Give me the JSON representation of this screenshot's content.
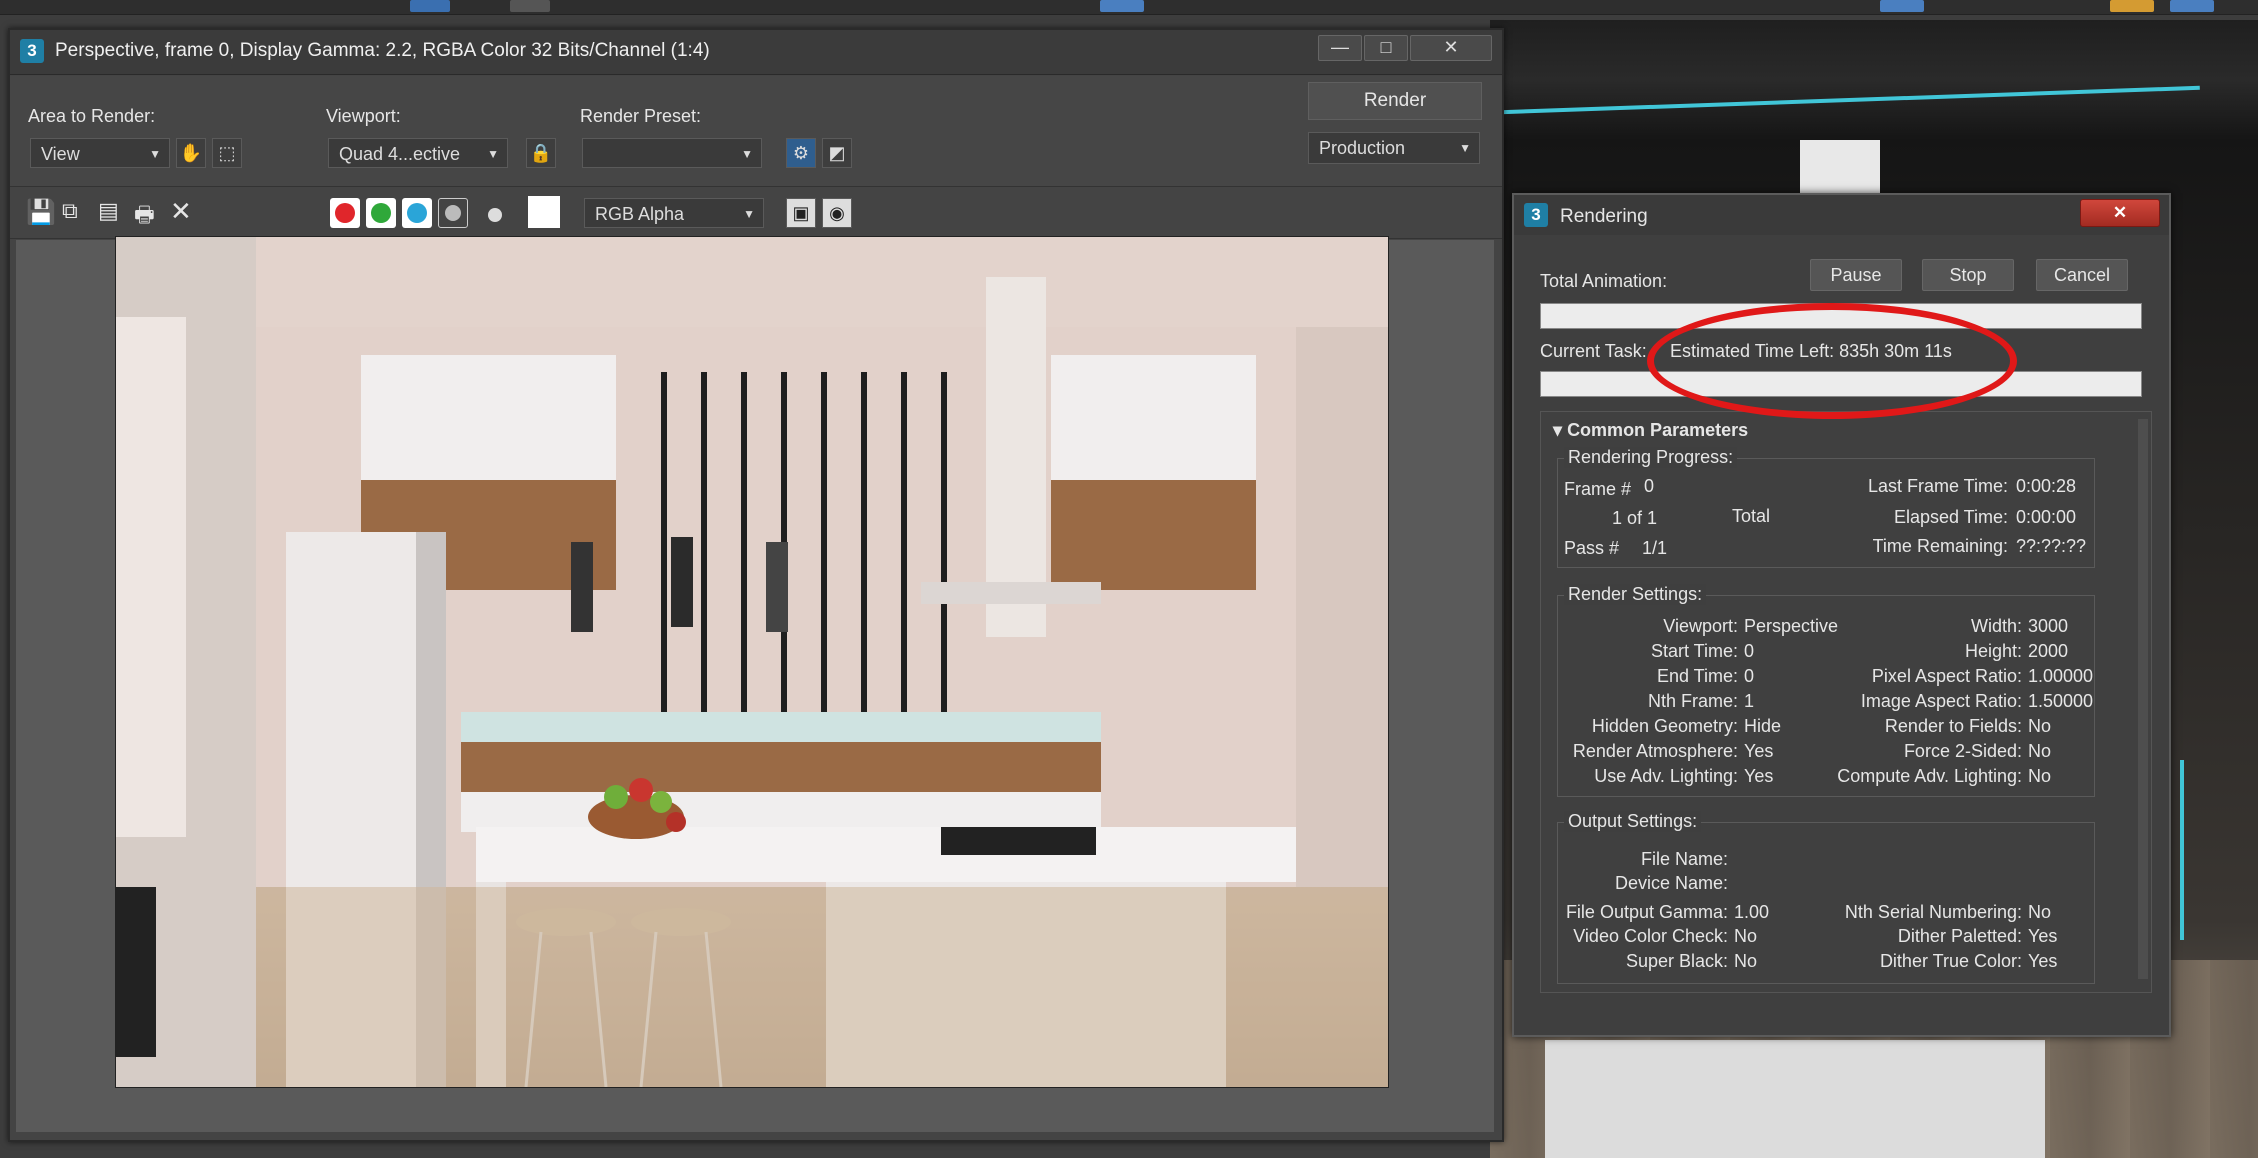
{
  "frame_window": {
    "title": "Perspective, frame 0, Display Gamma: 2.2, RGBA Color 32 Bits/Channel (1:4)",
    "app_icon": "3",
    "minimize": "—",
    "restore": "□",
    "close": "✕",
    "area_to_render_label": "Area to Render:",
    "area_to_render_value": "View",
    "viewport_label": "Viewport:",
    "viewport_value": "Quad 4...ective",
    "render_preset_label": "Render Preset:",
    "render_preset_value": "",
    "render_button": "Render",
    "production_value": "Production",
    "channel_value": "RGB Alpha",
    "channel_colors": {
      "red": "#e0262b",
      "green": "#2fa83a",
      "blue": "#2aa5d8"
    }
  },
  "rendering_dialog": {
    "icon": "3",
    "title": "Rendering",
    "close": "✕",
    "total_animation_label": "Total Animation:",
    "pause": "Pause",
    "stop": "Stop",
    "cancel": "Cancel",
    "current_task_label": "Current Task:",
    "current_task_value": "Estimated Time Left: 835h 30m 11s",
    "rollout_title": "Common Parameters",
    "progress": {
      "title": "Rendering Progress:",
      "frame_label": "Frame #",
      "frame_value": "0",
      "of_value": "1 of 1",
      "total_label": "Total",
      "pass_label": "Pass #",
      "pass_value": "1/1",
      "last_frame_time_label": "Last Frame Time:",
      "last_frame_time_value": "0:00:28",
      "elapsed_time_label": "Elapsed Time:",
      "elapsed_time_value": "0:00:00",
      "time_remaining_label": "Time Remaining:",
      "time_remaining_value": "??:??:??"
    },
    "render_settings": {
      "title": "Render Settings:",
      "left": [
        {
          "label": "Viewport:",
          "value": "Perspective"
        },
        {
          "label": "Start Time:",
          "value": "0"
        },
        {
          "label": "End Time:",
          "value": "0"
        },
        {
          "label": "Nth Frame:",
          "value": "1"
        },
        {
          "label": "Hidden Geometry:",
          "value": "Hide"
        },
        {
          "label": "Render Atmosphere:",
          "value": "Yes"
        },
        {
          "label": "Use Adv. Lighting:",
          "value": "Yes"
        }
      ],
      "right": [
        {
          "label": "Width:",
          "value": "3000"
        },
        {
          "label": "Height:",
          "value": "2000"
        },
        {
          "label": "Pixel Aspect Ratio:",
          "value": "1.00000"
        },
        {
          "label": "Image Aspect Ratio:",
          "value": "1.50000"
        },
        {
          "label": "Render to Fields:",
          "value": "No"
        },
        {
          "label": "Force 2-Sided:",
          "value": "No"
        },
        {
          "label": "Compute Adv. Lighting:",
          "value": "No"
        }
      ]
    },
    "output_settings": {
      "title": "Output Settings:",
      "file_name_label": "File Name:",
      "device_name_label": "Device Name:",
      "left": [
        {
          "label": "File Output Gamma:",
          "value": "1.00"
        },
        {
          "label": "Video Color Check:",
          "value": "No"
        },
        {
          "label": "Super Black:",
          "value": "No"
        }
      ],
      "right": [
        {
          "label": "Nth Serial Numbering:",
          "value": "No"
        },
        {
          "label": "Dither Paletted:",
          "value": "Yes"
        },
        {
          "label": "Dither True Color:",
          "value": "Yes"
        }
      ]
    }
  },
  "annotation": {
    "color": "#e01818"
  }
}
